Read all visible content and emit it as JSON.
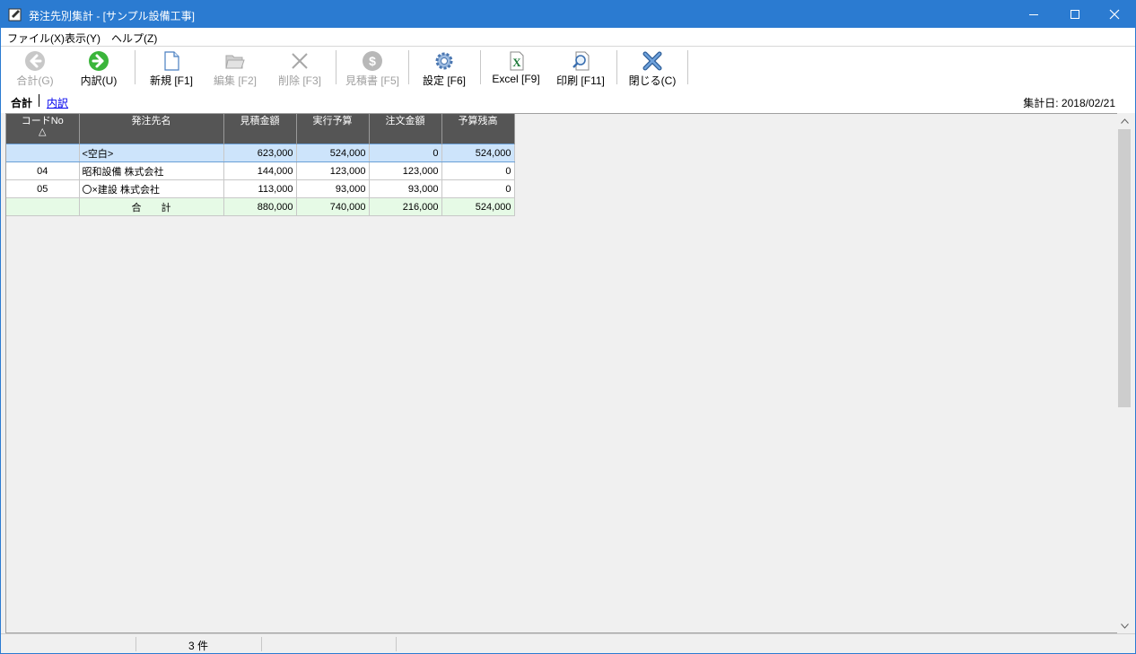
{
  "window": {
    "title": "発注先別集計 - [サンプル設備工事]"
  },
  "menu": [
    {
      "label": "ファイル(X)"
    },
    {
      "label": "表示(Y)"
    },
    {
      "label": "ヘルプ(Z)"
    }
  ],
  "toolbar": {
    "gokei": "合計(G)",
    "uchiwake": "内訳(U)",
    "shinki": "新規 [F1]",
    "henshu": "編集 [F2]",
    "sakujo": "削除 [F3]",
    "mitsumorisho": "見積書 [F5]",
    "settei": "設定 [F6]",
    "excel": "Excel [F9]",
    "insatsu": "印刷 [F11]",
    "tojiru": "閉じる(C)"
  },
  "subheader": {
    "mode_total": "合計",
    "mode_detail": "内訳",
    "aggregate_date": "集計日: 2018/02/21"
  },
  "table": {
    "headers": {
      "code": "コードNo",
      "code_sort": "△",
      "name": "発注先名",
      "estimate": "見積金額",
      "budget": "実行予算",
      "order": "注文金額",
      "remain": "予算残高"
    },
    "rows": [
      {
        "code": "",
        "name": "<空白>",
        "estimate": "623,000",
        "budget": "524,000",
        "order": "0",
        "remain": "524,000"
      },
      {
        "code": "04",
        "name": "昭和設備 株式会社",
        "estimate": "144,000",
        "budget": "123,000",
        "order": "123,000",
        "remain": "0"
      },
      {
        "code": "05",
        "name": "〇×建設 株式会社",
        "estimate": "113,000",
        "budget": "93,000",
        "order": "93,000",
        "remain": "0"
      }
    ],
    "total": {
      "code": "",
      "name": "合　　計",
      "estimate": "880,000",
      "budget": "740,000",
      "order": "216,000",
      "remain": "524,000"
    }
  },
  "status": {
    "count": "3 件"
  },
  "colors": {
    "titlebar": "#2b7bd1",
    "header": "#555555",
    "selected_row": "#cde4fb",
    "total_row": "#e6fae6"
  }
}
